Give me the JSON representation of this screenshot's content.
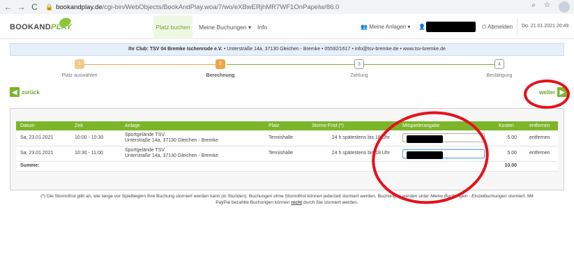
{
  "browser": {
    "back": "←",
    "forward": "→",
    "reload": "C",
    "url_host": "bookandplay.de",
    "url_path": "/cgi-bin/WebObjects/BookAndPlay.woa/7/wo/eXBwERjhMR7WF1OnPapelw/86.0"
  },
  "nav": {
    "logo_book": "BOOKAND",
    "logo_play": "PLAY",
    "platz_buchen": "Platz buchen",
    "meine_buchungen": "Meine Buchungen ▾",
    "info": "Info",
    "meine_anlagen": "Meine Anlagen ▾",
    "abmelden": "Abmelden",
    "date": "Do. 21.01.2021 20:49"
  },
  "club": {
    "name": "Ihr Club: TSV 04 Bremke Ischenrode e.V.",
    "details": "• Unterstraße 14a, 37130 Gleichen - Bremke • 05592/1617 • info@tsv-bremke.de • www.tsv-bremke.de"
  },
  "steps": [
    {
      "num": "1",
      "label": "Platz auswählen"
    },
    {
      "num": "2",
      "label": "Berechnung"
    },
    {
      "num": "3",
      "label": "Zahlung"
    },
    {
      "num": "4",
      "label": "Bestätigung"
    }
  ],
  "buttons": {
    "back": "zurück",
    "next": "weiter"
  },
  "table": {
    "headers": [
      "Datum",
      "Zeit",
      "Anlage",
      "Platz",
      "Storno-Frist (*)",
      "Mitspielerangabe",
      "Kosten",
      "entfernen"
    ],
    "rows": [
      {
        "datum": "Sa, 23.01.2021",
        "zeit": "10:00 - 10:30",
        "anlage1": "Sportgelände TSV",
        "anlage2": "Unterstraße 14a, 37130 Gleichen - Bremke",
        "platz": "Tennishalle",
        "storno": "24 h spätestens bis 18 Uhr",
        "kosten": "5.00",
        "entfernen": "entfernen"
      },
      {
        "datum": "Sa, 23.01.2021",
        "zeit": "10:30 - 11:00",
        "anlage1": "Sportgelände TSV",
        "anlage2": "Unterstraße 14a, 37130 Gleichen - Bremke",
        "platz": "Tennishalle",
        "storno": "24 h spätestens bis 18 Uhr",
        "kosten": "5.00",
        "entfernen": "entfernen"
      }
    ],
    "sum_label": "Summe:",
    "sum_value": "10.00"
  },
  "footnote": {
    "part1": "(*) Die Stornofrist gibt an, wie lange vor Spielbeginn Ihre Buchung storniert werden kann (in Stunden). Buchungen ohne Stornofrist können jederzeit storniert werden. Buchungen werden unter",
    "italic": "Meine Buchungen - Einzelbuchungen",
    "part2": "storniert. Mit",
    "line2a": "PayPal bezahlte Buchungen können",
    "nicht": "nicht",
    "line2b": "durch Sie storniert werden."
  },
  "colors": {
    "accent_green": "#7bb52a",
    "step_orange": "#f0a548",
    "annotation_red": "#e8101a"
  }
}
